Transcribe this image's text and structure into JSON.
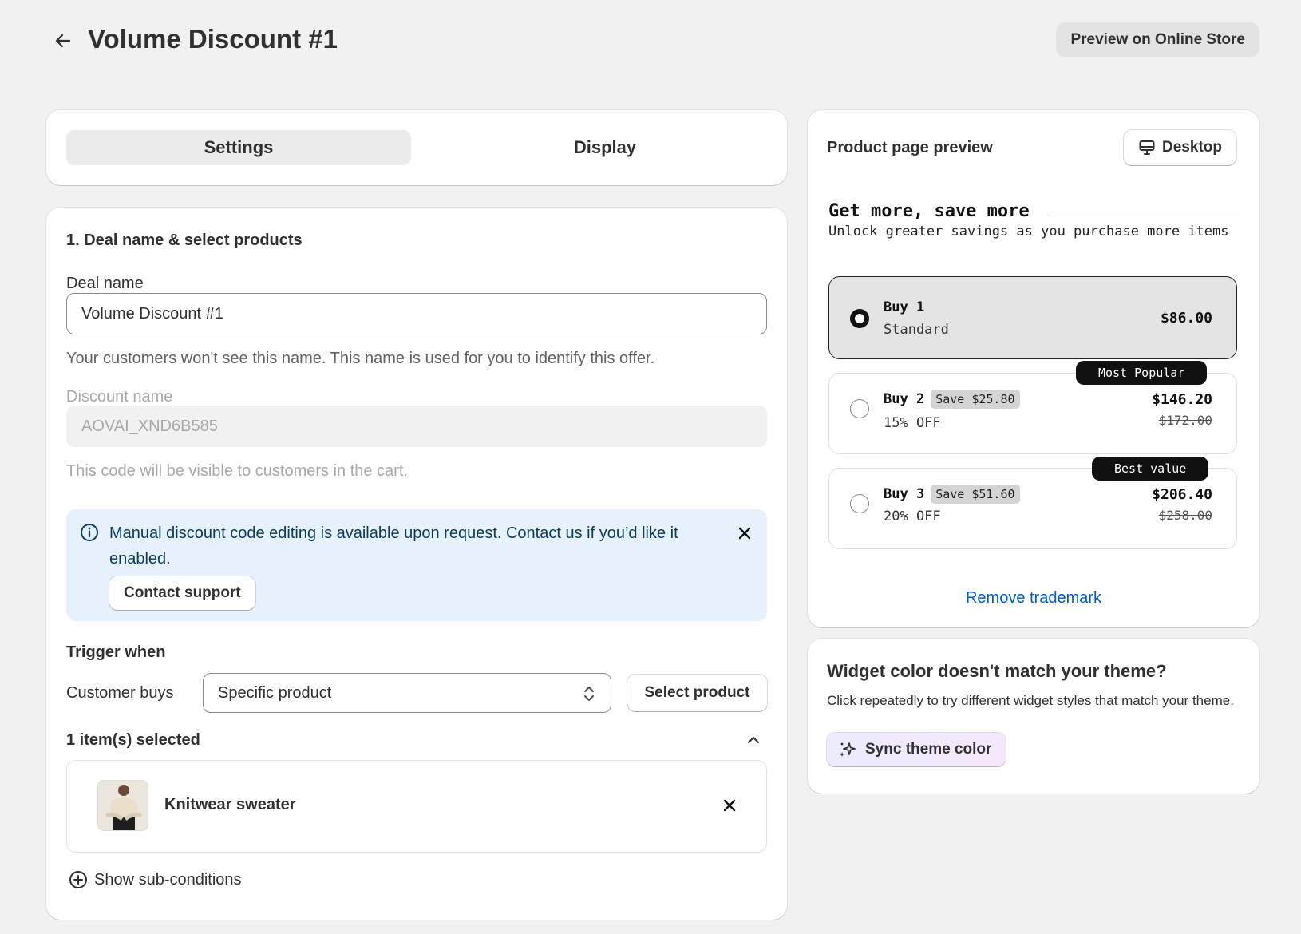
{
  "header": {
    "title": "Volume Discount #1",
    "preview_button": "Preview on Online Store"
  },
  "tabs": [
    {
      "label": "Settings",
      "active": true
    },
    {
      "label": "Display",
      "active": false
    }
  ],
  "deal": {
    "section_title": "1. Deal name & select products",
    "deal_name_label": "Deal name",
    "deal_name_value": "Volume Discount #1",
    "deal_name_help": "Your customers won't see this name. This name is used for you to identify this offer.",
    "discount_name_label": "Discount name",
    "discount_name_value": "AOVAI_XND6B585",
    "discount_name_help": "This code will be visible to customers in the cart.",
    "banner_text": "Manual discount code editing is available upon request. Contact us if you’d like it enabled.",
    "contact_button": "Contact support",
    "trigger_title": "Trigger when",
    "customer_buys_label": "Customer buys",
    "customer_buys_value": "Specific product",
    "select_product_button": "Select product",
    "items_selected": "1 item(s) selected",
    "product_name": "Knitwear sweater",
    "show_subconditions": "Show sub-conditions"
  },
  "preview": {
    "title": "Product page preview",
    "device_button": "Desktop",
    "widget_heading": "Get more, save more",
    "widget_subheading": "Unlock greater savings as you purchase more items",
    "tiers": [
      {
        "title": "Buy 1",
        "subtitle": "Standard",
        "price": "$86.00",
        "selected": true
      },
      {
        "title": "Buy 2",
        "save": "Save $25.80",
        "subtitle": "15% OFF",
        "price": "$146.20",
        "original": "$172.00",
        "badge": "Most Popular"
      },
      {
        "title": "Buy 3",
        "save": "Save $51.60",
        "subtitle": "20% OFF",
        "price": "$206.40",
        "original": "$258.00",
        "badge": "Best value"
      }
    ],
    "remove_trademark": "Remove trademark"
  },
  "theme": {
    "title": "Widget color doesn't match your theme?",
    "description": "Click repeatedly to try different widget styles that match your theme.",
    "sync_button": "Sync theme color"
  },
  "colors": {
    "background": "#f1f1f1",
    "banner": "#e6f1fb",
    "link": "#005bd3",
    "badge": "#111111"
  },
  "icons": [
    "arrow-left-icon",
    "info-icon",
    "close-icon",
    "select-chevrons-icon",
    "chevron-up-icon",
    "plus-circle-icon",
    "monitor-icon",
    "sparkle-icon"
  ]
}
